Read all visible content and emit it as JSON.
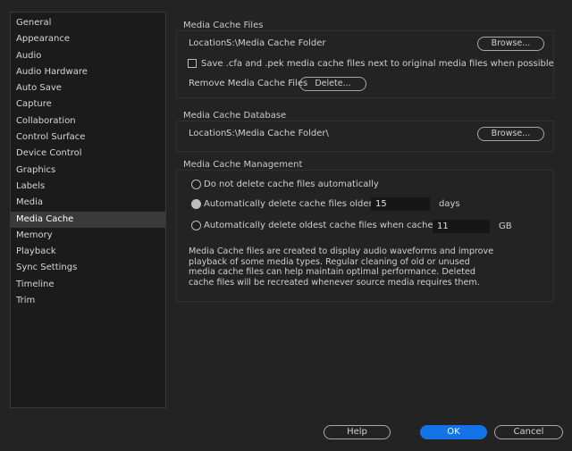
{
  "sidebar": {
    "items": [
      {
        "label": "General"
      },
      {
        "label": "Appearance"
      },
      {
        "label": "Audio"
      },
      {
        "label": "Audio Hardware"
      },
      {
        "label": "Auto Save"
      },
      {
        "label": "Capture"
      },
      {
        "label": "Collaboration"
      },
      {
        "label": "Control Surface"
      },
      {
        "label": "Device Control"
      },
      {
        "label": "Graphics"
      },
      {
        "label": "Labels"
      },
      {
        "label": "Media"
      },
      {
        "label": "Media Cache"
      },
      {
        "label": "Memory"
      },
      {
        "label": "Playback"
      },
      {
        "label": "Sync Settings"
      },
      {
        "label": "Timeline"
      },
      {
        "label": "Trim"
      }
    ],
    "selected": "Media Cache"
  },
  "cache_files": {
    "title": "Media Cache Files",
    "location_label": "Location:",
    "location_value": "S:\\Media Cache Folder",
    "browse_label": "Browse...",
    "save_checkbox_label": "Save .cfa and .pek media cache files next to original media files when possible",
    "save_checked": false,
    "remove_label": "Remove Media Cache Files",
    "delete_label": "Delete..."
  },
  "cache_database": {
    "title": "Media Cache Database",
    "location_label": "Location:",
    "location_value": "S:\\Media Cache Folder\\",
    "browse_label": "Browse..."
  },
  "cache_management": {
    "title": "Media Cache Management",
    "option_none": "Do not delete cache files automatically",
    "option_older": "Automatically delete cache files older than:",
    "older_value": "15",
    "older_unit": "days",
    "option_exceeds": "Automatically delete oldest cache files when cache exceeds:",
    "exceeds_value": "11",
    "exceeds_unit": "GB",
    "selected_option": "older",
    "description": "Media Cache files are created to display audio waveforms and improve playback of some media types.  Regular cleaning of old or unused media cache files can help maintain optimal performance. Deleted cache files will be recreated whenever source media requires them."
  },
  "footer": {
    "help_label": "Help",
    "ok_label": "OK",
    "cancel_label": "Cancel"
  },
  "colors": {
    "accent": "#1473e6",
    "background": "#232323",
    "sidebar_bg": "#1b1b1b",
    "selected_item_bg": "#3a3a3a"
  }
}
